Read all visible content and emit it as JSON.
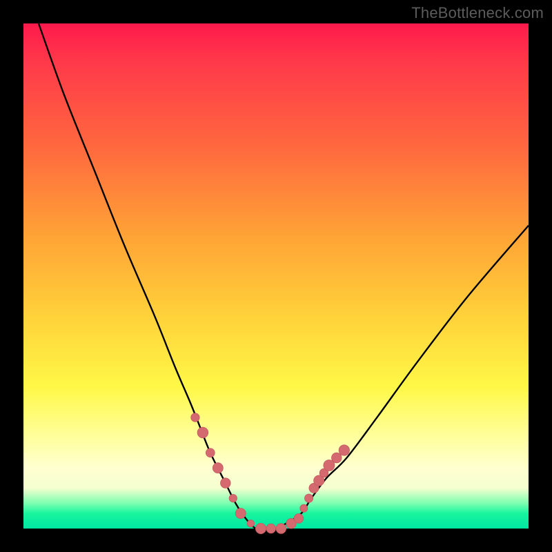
{
  "watermark": "TheBottleneck.com",
  "colors": {
    "frame": "#000000",
    "curve": "#000000",
    "marker_fill": "#d46a6f",
    "marker_stroke": "#c25a60"
  },
  "chart_data": {
    "type": "line",
    "title": "",
    "xlabel": "",
    "ylabel": "",
    "xlim": [
      0,
      100
    ],
    "ylim": [
      0,
      100
    ],
    "note": "No axes/ticks rendered; values estimated from curve shape. y is a bottleneck-percentage-like metric that drops to ~0 at the optimum then rises again.",
    "series": [
      {
        "name": "bottleneck-curve",
        "x": [
          3,
          8,
          14,
          20,
          26,
          30,
          33,
          35,
          37,
          40,
          42,
          44,
          46,
          48,
          50,
          52,
          55,
          57,
          60,
          64,
          70,
          78,
          88,
          100
        ],
        "y": [
          100,
          86,
          71,
          56,
          42,
          32,
          25,
          20,
          15,
          9,
          5,
          2,
          0,
          0,
          0,
          1,
          3,
          6,
          10,
          14,
          22,
          33,
          46,
          60
        ]
      }
    ],
    "markers": {
      "name": "sample-points",
      "note": "pink dot clusters along both arms near the trough",
      "x": [
        34,
        35.5,
        37,
        38.5,
        40,
        41.5,
        43,
        45,
        47,
        49,
        51,
        53,
        54.5,
        55.5,
        56.5,
        57.5,
        58.5,
        59.5,
        60.5,
        62,
        63.5
      ],
      "y": [
        22,
        19,
        15,
        12,
        9,
        6,
        3,
        1,
        0,
        0,
        0,
        1,
        2,
        4,
        6,
        8,
        9.5,
        11,
        12.5,
        14,
        15.5
      ]
    }
  }
}
